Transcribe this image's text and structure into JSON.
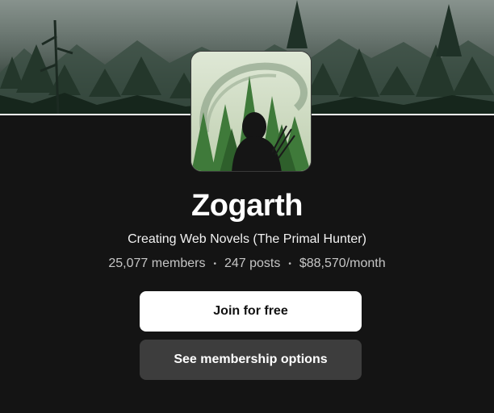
{
  "creator": {
    "name": "Zogarth",
    "tagline": "Creating Web Novels (The Primal Hunter)"
  },
  "stats": {
    "members": "25,077 members",
    "posts": "247 posts",
    "earnings": "$88,570/month",
    "separator": "•"
  },
  "actions": {
    "join_label": "Join for free",
    "membership_label": "See membership options"
  },
  "colors": {
    "background": "#141414",
    "primary_button": "#ffffff",
    "secondary_button": "#3d3d3d"
  }
}
